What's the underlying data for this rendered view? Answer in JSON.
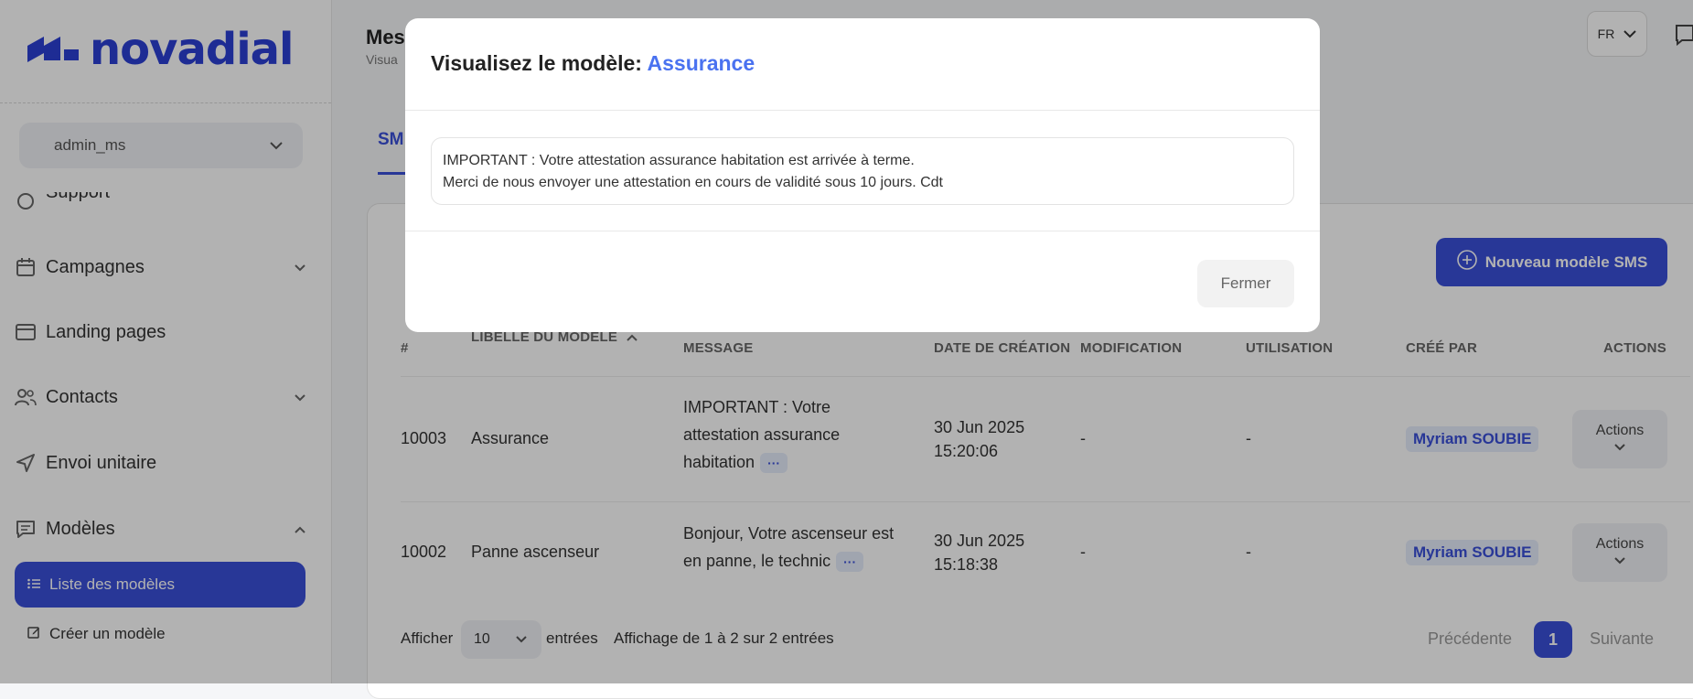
{
  "brand": {
    "name": "novadial",
    "color": "#2b3fd4"
  },
  "sidebar": {
    "user": "admin_ms",
    "partial_item": "Support",
    "items": [
      {
        "label": "Campagnes",
        "icon": "calendar-icon",
        "expandable": true
      },
      {
        "label": "Landing pages",
        "icon": "browser-window-icon",
        "expandable": false
      },
      {
        "label": "Contacts",
        "icon": "users-icon",
        "expandable": true
      },
      {
        "label": "Envoi unitaire",
        "icon": "send-icon",
        "expandable": false
      },
      {
        "label": "Modèles",
        "icon": "message-square-icon",
        "expandable": true
      }
    ],
    "sub_items": [
      {
        "label": "Liste des modèles",
        "icon": "list-icon",
        "active": true
      },
      {
        "label": "Créer un modèle",
        "icon": "edit-icon",
        "active": false
      }
    ]
  },
  "header": {
    "title": "Mes",
    "subtitle": "Visua",
    "lang": "FR"
  },
  "tabs": {
    "active": "SM"
  },
  "toolbar": {
    "new_button": "Nouveau modèle SMS"
  },
  "table": {
    "columns": [
      "#",
      "LIBELLE DU MODELE",
      "MESSAGE",
      "DATE DE CRÉATION",
      "MODIFICATION",
      "UTILISATION",
      "CRÉÉ PAR",
      "ACTIONS"
    ],
    "rows": [
      {
        "id": "10003",
        "label": "Assurance",
        "message_lines": [
          "IMPORTANT : Votre",
          "attestation assurance",
          "habitation"
        ],
        "more": "···",
        "date": "30 Jun 2025",
        "time": "15:20:06",
        "modification": "-",
        "utilisation": "-",
        "creator": "Myriam SOUBIE",
        "actions": "Actions"
      },
      {
        "id": "10002",
        "label": "Panne ascenseur",
        "message_lines": [
          "Bonjour, Votre ascenseur est",
          "en panne, le technic"
        ],
        "more": "···",
        "date": "30 Jun 2025",
        "time": "15:18:38",
        "modification": "-",
        "utilisation": "-",
        "creator": "Myriam SOUBIE",
        "actions": "Actions"
      }
    ]
  },
  "footer": {
    "show_label": "Afficher",
    "page_size": "10",
    "entries_label": "entrées",
    "info": "Affichage de 1 à 2 sur 2 entrées",
    "prev": "Précédente",
    "page": "1",
    "next": "Suivante"
  },
  "modal": {
    "title_prefix": "Visualisez le modèle:",
    "title_name": "Assurance",
    "message": "IMPORTANT : Votre attestation assurance habitation est arrivée à terme.\nMerci de nous envoyer une attestation en cours de validité sous 10 jours. Cdt",
    "close": "Fermer"
  },
  "colors": {
    "accent": "#3a4fd8",
    "modal_accent": "#4a72f0"
  }
}
